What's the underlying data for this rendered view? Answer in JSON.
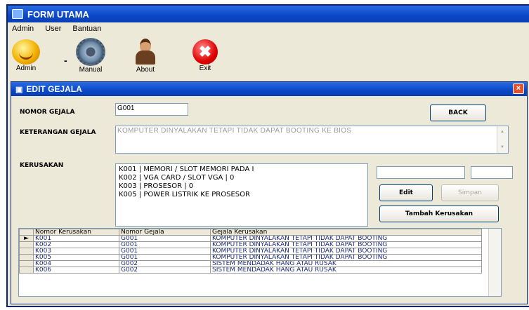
{
  "window": {
    "title": "FORM UTAMA"
  },
  "menu": [
    "Admin",
    "User",
    "Bantuan"
  ],
  "toolbar": {
    "admin": {
      "label": "Admin",
      "icon": "smiley-icon"
    },
    "manual": {
      "label": "Manual",
      "icon": "gear-icon"
    },
    "separator": "-",
    "about": {
      "label": "About",
      "icon": "person-icon"
    },
    "exit": {
      "label": "Exit",
      "icon": "close-icon"
    }
  },
  "dialog": {
    "title": "EDIT GEJALA",
    "close_glyph": "×",
    "nomor_gejala": {
      "label": "NOMOR GEJALA",
      "value": "G001"
    },
    "keterangan": {
      "label": "KETERANGAN GEJALA",
      "value": "KOMPUTER DINYALAKAN TETAPI TIDAK DAPAT BOOTING KE BIOS"
    },
    "kerusakan": {
      "label": "KERUSAKAN",
      "items": [
        "K001   |   MEMORI / SLOT MEMORI PADA I",
        "K002   |   VGA CARD / SLOT VGA   |   0",
        "K003   |   PROSESOR   |   0",
        "K005   |   POWER LISTRIK KE PROSESOR"
      ],
      "field1": "",
      "field2": ""
    },
    "buttons": {
      "back": "BACK",
      "edit": "Edit",
      "simpan": "Simpan",
      "tambah": "Tambah Kerusakan"
    },
    "grid": {
      "columns": [
        "Nomor Kerusakan",
        "Nomor Gejala",
        "Gejala Kerusakan"
      ],
      "rows": [
        [
          "K001",
          "G001",
          "KOMPUTER DINYALAKAN TETAPI TIDAK DAPAT BOOTING"
        ],
        [
          "K002",
          "G001",
          "KOMPUTER DINYALAKAN TETAPI TIDAK DAPAT BOOTING"
        ],
        [
          "K003",
          "G001",
          "KOMPUTER DINYALAKAN TETAPI TIDAK DAPAT BOOTING"
        ],
        [
          "K005",
          "G001",
          "KOMPUTER DINYALAKAN TETAPI TIDAK DAPAT BOOTING"
        ],
        [
          "K004",
          "G002",
          "SISTEM MENDADAK HANG ATAU RUSAK"
        ],
        [
          "K006",
          "G002",
          "SISTEM MENDADAK HANG ATAU RUSAK"
        ]
      ],
      "selected_row": 0,
      "row_indicator": "►"
    }
  },
  "colors": {
    "titlebar": "#0a47c8",
    "window_bg": "#ece9d8",
    "close_button": "#e0502a",
    "grid_text": "#1b2a7a"
  }
}
